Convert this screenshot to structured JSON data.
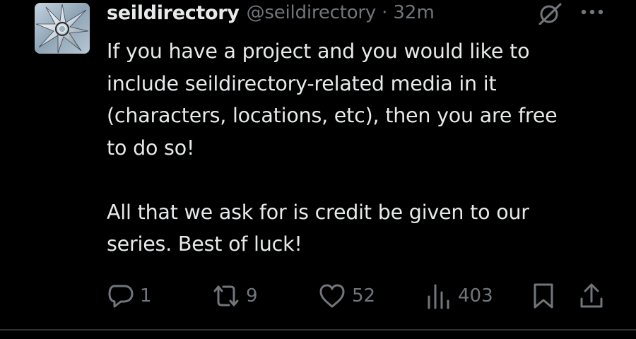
{
  "post": {
    "display_name": "seildirectory",
    "handle": "@seildirectory",
    "separator": "·",
    "time": "32m",
    "paragraphs": [
      "If you have a project and you would like to\ninclude seildirectory-related media in it\n(characters, locations, etc), then you are free\nto do so!",
      "All that we ask for is credit be given to our\nseries. Best of luck!"
    ]
  },
  "actions": {
    "replies": "1",
    "reposts": "9",
    "likes": "52",
    "views": "403"
  },
  "icons": {
    "header": [
      "grok-icon",
      "more-icon"
    ],
    "actions": [
      "reply-icon",
      "repost-icon",
      "like-icon",
      "views-icon",
      "bookmark-icon",
      "share-icon"
    ]
  },
  "colors": {
    "background": "#000000",
    "primary_text": "#e7e9ea",
    "secondary_text": "#71767b",
    "divider": "#2f3336"
  }
}
